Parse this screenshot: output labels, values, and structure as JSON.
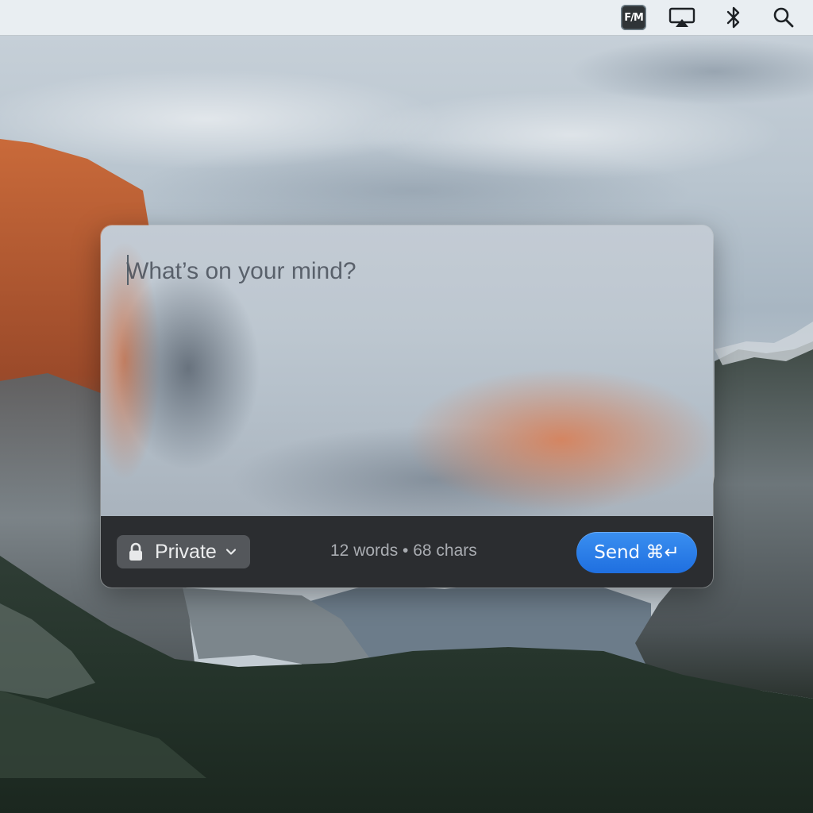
{
  "menubar": {
    "icons": {
      "app": "fm-app-icon",
      "airplay": "airplay-icon",
      "bluetooth": "bluetooth-icon",
      "search": "search-icon"
    },
    "app_badge_text": "F/M"
  },
  "composer": {
    "placeholder": "What’s on your mind?",
    "value": "",
    "privacy": {
      "selected": "Private",
      "icon": "lock-icon"
    },
    "stats": "12 words • 68 chars",
    "send_label": "Send ⌘↵",
    "accent_color": "#2a7de8"
  }
}
